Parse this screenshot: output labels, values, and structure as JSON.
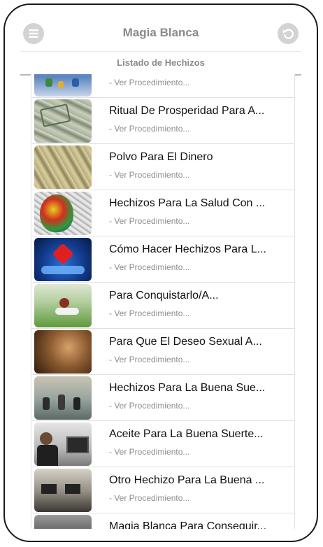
{
  "header": {
    "title": "Magia Blanca",
    "menu_icon": "menu-icon",
    "back_icon": "back-arrow-icon"
  },
  "subheader": {
    "title": "Listado de Hechizos"
  },
  "list": {
    "items": [
      {
        "title": "",
        "subtitle": "- Ver Procedimiento...",
        "thumb": "mini-figurines-photo"
      },
      {
        "title": "Ritual De Prosperidad Para A...",
        "subtitle": "- Ver Procedimiento...",
        "thumb": "banknotes-photo"
      },
      {
        "title": "Polvo Para El Dinero",
        "subtitle": "- Ver Procedimiento...",
        "thumb": "money-pile-photo"
      },
      {
        "title": "Hechizos Para La Salud Con ...",
        "subtitle": "- Ver Procedimiento...",
        "thumb": "colorful-heart-art"
      },
      {
        "title": "Cómo Hacer Hechizos Para L...",
        "subtitle": "- Ver Procedimiento...",
        "thumb": "hands-heart-photo"
      },
      {
        "title": "Para Conquistarlo/A...",
        "subtitle": "- Ver Procedimiento...",
        "thumb": "woman-grass-photo"
      },
      {
        "title": "Para Que El Deseo Sexual A...",
        "subtitle": "- Ver Procedimiento...",
        "thumb": "couple-photo"
      },
      {
        "title": "Hechizos Para La Buena Sue...",
        "subtitle": "- Ver Procedimiento...",
        "thumb": "office-team-photo"
      },
      {
        "title": "Aceite Para La Buena Suerte...",
        "subtitle": "- Ver Procedimiento...",
        "thumb": "office-worker-photo"
      },
      {
        "title": "Otro Hechizo Para La Buena ...",
        "subtitle": "- Ver Procedimiento...",
        "thumb": "office-desks-photo"
      },
      {
        "title": "Magia Blanca Para Conseguir...",
        "subtitle": "",
        "thumb": "dark-office-photo"
      }
    ]
  }
}
